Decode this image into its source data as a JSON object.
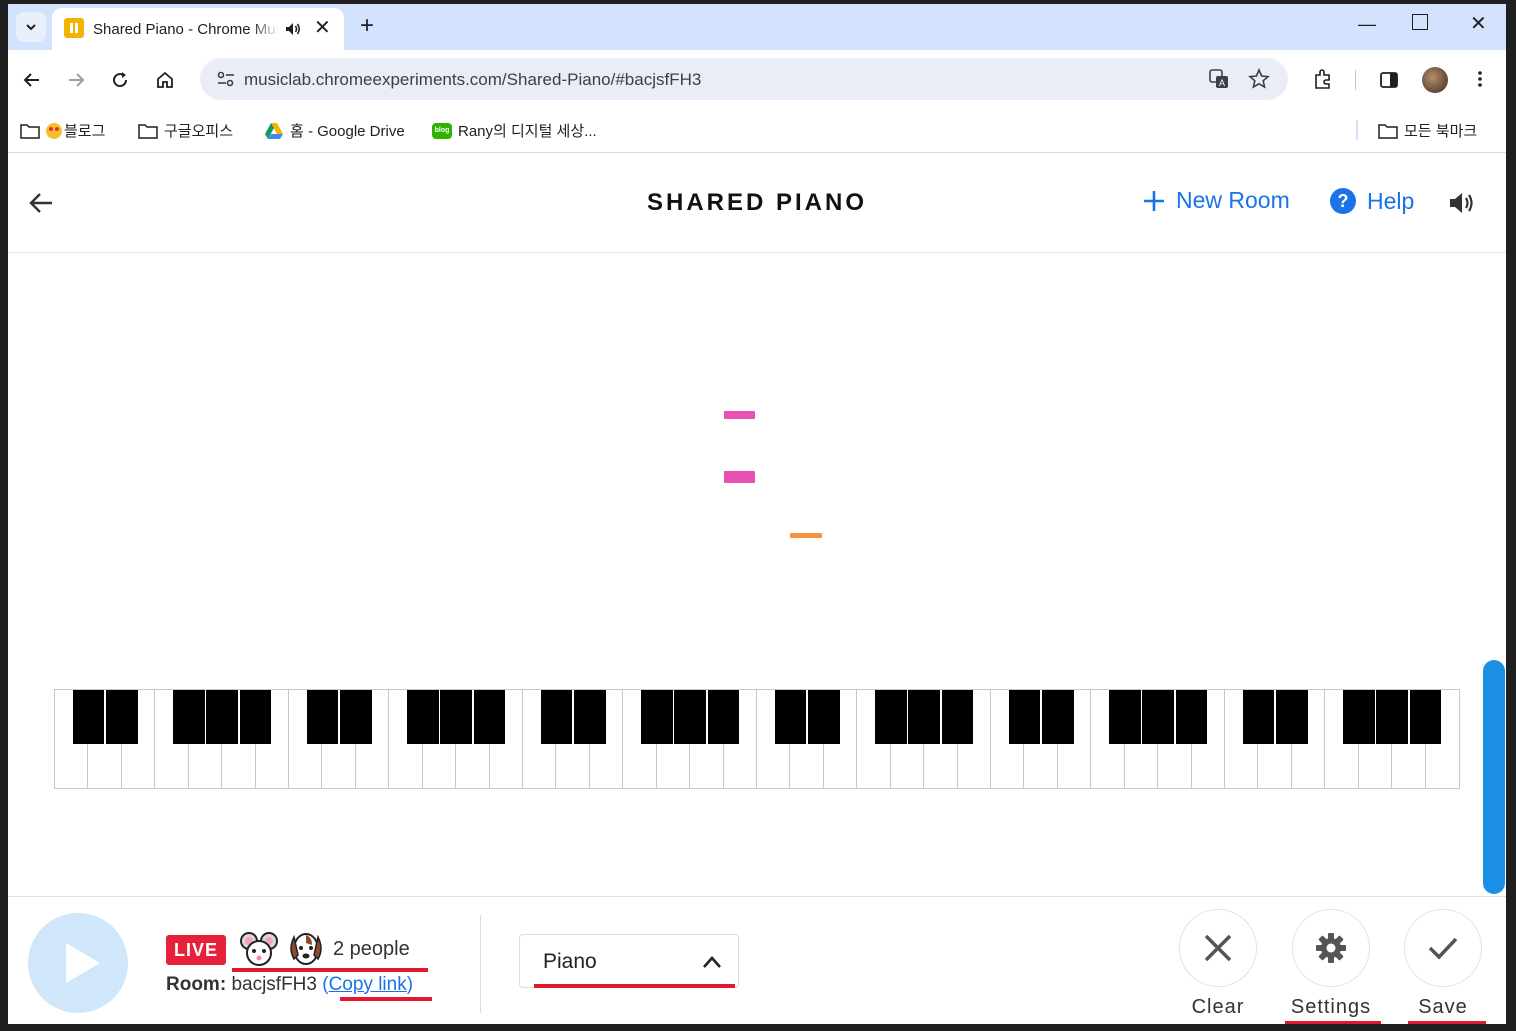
{
  "browser": {
    "tab": {
      "title": "Shared Piano - Chrome Music Lab"
    },
    "url": "musiclab.chromeexperiments.com/Shared-Piano/#bacjsfFH3",
    "bookmarks": [
      {
        "label": "블로그"
      },
      {
        "label": "구글오피스"
      },
      {
        "label": "홈 - Google Drive"
      },
      {
        "label": "Rany의 디지털 세상..."
      }
    ],
    "all_bookmarks": "모든 북마크"
  },
  "app": {
    "title": "SHARED PIANO",
    "new_room_label": "New Room",
    "help_label": "Help"
  },
  "footer": {
    "live_badge": "LIVE",
    "people_count": "2 people",
    "room_label": "Room:",
    "room_id": "bacjsfFH3",
    "copy_link": "Copy link",
    "instrument": "Piano",
    "clear_label": "Clear",
    "settings_label": "Settings",
    "save_label": "Save"
  },
  "colors": {
    "accent": "#1a73e8",
    "live_red": "#e8213a",
    "note_pink": "#e94fb5",
    "note_orange": "#f5923e",
    "scrollbar_blue": "#1a8fe3",
    "play_bg": "#cfe6fb"
  },
  "icons": [
    "back-arrow-icon",
    "plus-icon",
    "help-circle-icon",
    "speaker-icon",
    "play-icon",
    "close-x-icon",
    "gear-icon",
    "checkmark-icon",
    "chevron-up-icon",
    "mouse-emoji-avatar",
    "dog-emoji-avatar"
  ]
}
